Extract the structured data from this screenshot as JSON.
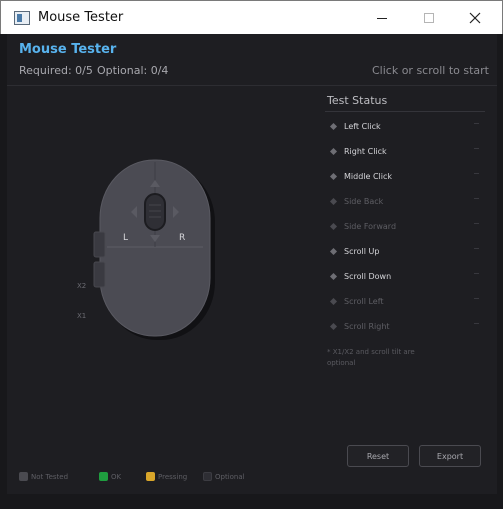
{
  "window": {
    "title": "Mouse Tester",
    "controls": [
      "minimize",
      "maximize",
      "close"
    ]
  },
  "header": {
    "app_title": "Mouse Tester",
    "required": "Required: 0/5",
    "optional": "Optional: 0/4",
    "hint": "Click or scroll to start"
  },
  "mouse": {
    "left_label": "L",
    "right_label": "R",
    "x2_label": "X2",
    "x1_label": "X1"
  },
  "status": {
    "title": "Test Status",
    "items": [
      {
        "label": "Left Click",
        "optional": false
      },
      {
        "label": "Right Click",
        "optional": false
      },
      {
        "label": "Middle Click",
        "optional": false
      },
      {
        "label": "Side Back",
        "optional": true
      },
      {
        "label": "Side Forward",
        "optional": true
      },
      {
        "label": "Scroll Up",
        "optional": false
      },
      {
        "label": "Scroll Down",
        "optional": false
      },
      {
        "label": "Scroll Left",
        "optional": true
      },
      {
        "label": "Scroll Right",
        "optional": true
      }
    ],
    "note": "* X1/X2 and scroll tilt are optional"
  },
  "buttons": {
    "reset": "Reset",
    "export": "Export"
  },
  "legend": [
    {
      "label": "Not Tested",
      "color": "#4a4a50"
    },
    {
      "label": "OK",
      "color": "#1f9d3f"
    },
    {
      "label": "Pressing",
      "color": "#d9a62a"
    },
    {
      "label": "Optional",
      "color": "#2e2e34"
    }
  ],
  "colors": {
    "accent": "#58b3ee",
    "background": "#1e1e22",
    "mouse_body": "#4b4b53"
  }
}
